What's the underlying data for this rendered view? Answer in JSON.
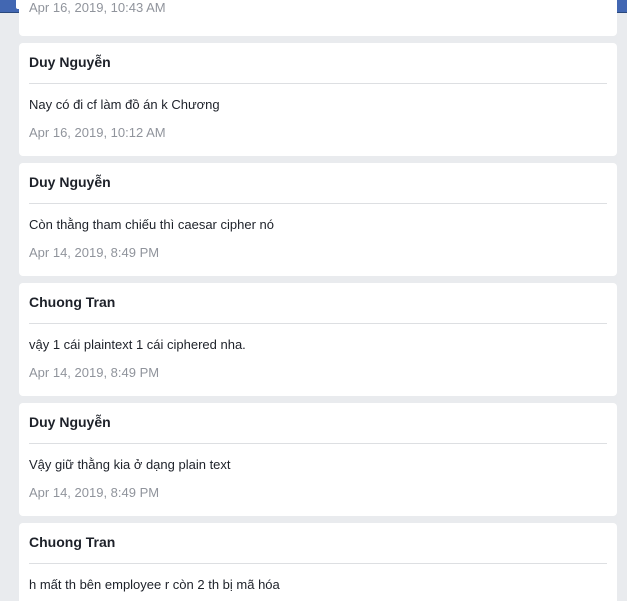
{
  "messages": [
    {
      "text": "",
      "timestamp": "Apr 16, 2019, 10:43 AM"
    },
    {
      "author": "Duy Nguyễn",
      "text": "Nay có đi cf làm đồ án k Chương",
      "timestamp": "Apr 16, 2019, 10:12 AM"
    },
    {
      "author": "Duy Nguyễn",
      "text": "Còn thằng tham chiếu thì caesar cipher nó",
      "timestamp": "Apr 14, 2019, 8:49 PM"
    },
    {
      "author": "Chuong Tran",
      "text": "vậy 1 cái plaintext 1 cái ciphered nha.",
      "timestamp": "Apr 14, 2019, 8:49 PM"
    },
    {
      "author": "Duy Nguyễn",
      "text": "Vậy giữ thằng kia ở dạng plain text",
      "timestamp": "Apr 14, 2019, 8:49 PM"
    },
    {
      "author": "Chuong Tran",
      "text": "h mất th bên employee r còn 2 th bị mã hóa",
      "timestamp": ""
    }
  ],
  "colors": {
    "topbar": "#4267b2",
    "page_bg": "#e9ebee",
    "card_bg": "#ffffff",
    "author_text": "#1d2129",
    "timestamp_text": "#90949c",
    "divider": "#dddfe2"
  },
  "icons": {
    "logo": "facebook-logo-icon",
    "profile": "profile-avatar-icon"
  }
}
